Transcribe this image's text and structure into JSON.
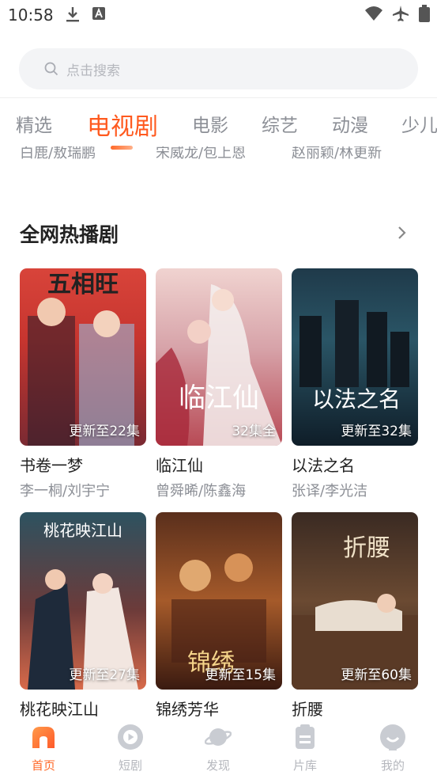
{
  "status_bar": {
    "time": "10:58"
  },
  "search": {
    "placeholder": "点击搜索"
  },
  "tabs": [
    {
      "label": "精选"
    },
    {
      "label": "电视剧",
      "active": true
    },
    {
      "label": "电影"
    },
    {
      "label": "综艺"
    },
    {
      "label": "动漫"
    },
    {
      "label": "少儿"
    }
  ],
  "clipped_casts": [
    "白鹿/敖瑞鹏",
    "宋威龙/包上恩",
    "赵丽颖/林更新"
  ],
  "section": {
    "title": "全网热播剧"
  },
  "shows": [
    {
      "title": "书卷一梦",
      "cast": "李一桐/刘宇宁",
      "badge": "更新至22集",
      "poster_text": "五相旺"
    },
    {
      "title": "临江仙",
      "cast": "曾舜晞/陈鑫海",
      "badge": "32集全",
      "poster_text": "临江仙"
    },
    {
      "title": "以法之名",
      "cast": "张译/李光洁",
      "badge": "更新至32集",
      "poster_text": "以法之名"
    },
    {
      "title": "桃花映江山",
      "cast": "",
      "badge": "更新至27集",
      "poster_text": "桃花映江山"
    },
    {
      "title": "锦绣芳华",
      "cast": "",
      "badge": "更新至15集",
      "poster_text": "锦绣"
    },
    {
      "title": "折腰",
      "cast": "",
      "badge": "更新至60集",
      "poster_text": "折腰"
    }
  ],
  "bottom_nav": [
    {
      "label": "首页",
      "icon": "home-icon",
      "active": true
    },
    {
      "label": "短剧",
      "icon": "play-icon"
    },
    {
      "label": "发现",
      "icon": "planet-icon"
    },
    {
      "label": "片库",
      "icon": "library-icon"
    },
    {
      "label": "我的",
      "icon": "profile-icon"
    }
  ],
  "colors": {
    "accent": "#ff5a1f",
    "text_muted": "#8c8f96",
    "search_bg": "#f3f4f6"
  }
}
